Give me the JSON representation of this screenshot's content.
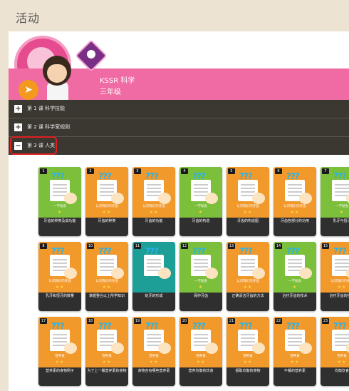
{
  "page": {
    "title": "活动"
  },
  "banner": {
    "course": "KSSR 科学",
    "grade": "三年级",
    "back_icon": "paper-plane-icon",
    "colors": {
      "banner_pink": "#f06aa3",
      "accordion_dark": "#3b3731",
      "highlight_red": "#e02020"
    }
  },
  "accordion": [
    {
      "label": "第 1 课 科学技能",
      "state": "collapsed",
      "icon": "plus-icon"
    },
    {
      "label": "第 2 课 科学室规则",
      "state": "collapsed",
      "icon": "plus-icon"
    },
    {
      "label": "第 3 课 人类",
      "state": "expanded",
      "icon": "minus-icon"
    }
  ],
  "cards": [
    {
      "num": "1",
      "color": "green",
      "sub": "一学就会",
      "stars": "★",
      "title": "牙齿的种类及其功能"
    },
    {
      "num": "2",
      "color": "orange",
      "sub": "认识我们的牙齿",
      "stars": "★★",
      "title": "牙齿的种类"
    },
    {
      "num": "3",
      "color": "orange",
      "sub": "认识我们的牙齿",
      "stars": "★★",
      "title": "牙齿的功能"
    },
    {
      "num": "4",
      "color": "green",
      "sub": "一学就会",
      "stars": "★",
      "title": "牙齿的构造"
    },
    {
      "num": "5",
      "color": "orange",
      "sub": "认识我们的牙齿",
      "stars": "★★",
      "title": "牙齿的构造图"
    },
    {
      "num": "6",
      "color": "orange",
      "sub": "认识我们的牙齿",
      "stars": "★★",
      "title": "牙齿各部分的功用"
    },
    {
      "num": "7",
      "color": "green",
      "sub": "一学就会",
      "stars": "★",
      "title": "乳牙与恒牙"
    },
    {
      "num": "8",
      "color": "orange",
      "sub": "认识我们的牙齿",
      "stars": "★★",
      "title": "乳牙和恒牙的数量"
    },
    {
      "num": "10",
      "color": "orange",
      "sub": "认识我们的牙齿",
      "stars": "★★",
      "title": "掌握整合以上所学知识"
    },
    {
      "num": "11",
      "color": "teal",
      "sub": "",
      "stars": "",
      "title": "蛀牙的形成"
    },
    {
      "num": "12",
      "color": "green",
      "sub": "一学就会",
      "stars": "★",
      "title": "保护牙齿"
    },
    {
      "num": "13",
      "color": "orange",
      "sub": "认识我们的牙齿",
      "stars": "★★",
      "title": "正确清洁牙齿的方法"
    },
    {
      "num": "14",
      "color": "green",
      "sub": "一学就会",
      "stars": "★",
      "title": "治疗牙齿的技术"
    },
    {
      "num": "15",
      "color": "orange",
      "sub": "认识我们的牙齿",
      "stars": "★★",
      "title": "治疗牙齿的技术"
    },
    {
      "num": "17",
      "color": "orange",
      "sub": "营养素",
      "stars": "★★",
      "title": "营养素的食物例子"
    },
    {
      "num": "18",
      "color": "orange",
      "sub": "营养素",
      "stars": "★★",
      "title": "为了上一餐营养素的食物"
    },
    {
      "num": "19",
      "color": "orange",
      "sub": "营养素",
      "stars": "★★",
      "title": "食物含有哪些营养素"
    },
    {
      "num": "20",
      "color": "orange",
      "sub": "营养素",
      "stars": "★★",
      "title": "营养均衡的饮食"
    },
    {
      "num": "21",
      "color": "orange",
      "sub": "营养素",
      "stars": "★★",
      "title": "摄取均衡的食物"
    },
    {
      "num": "22",
      "color": "orange",
      "sub": "营养素",
      "stars": "★★",
      "title": "午餐的营养素"
    },
    {
      "num": "23",
      "color": "orange",
      "sub": "营养素",
      "stars": "★★",
      "title": "均衡饮食"
    }
  ]
}
